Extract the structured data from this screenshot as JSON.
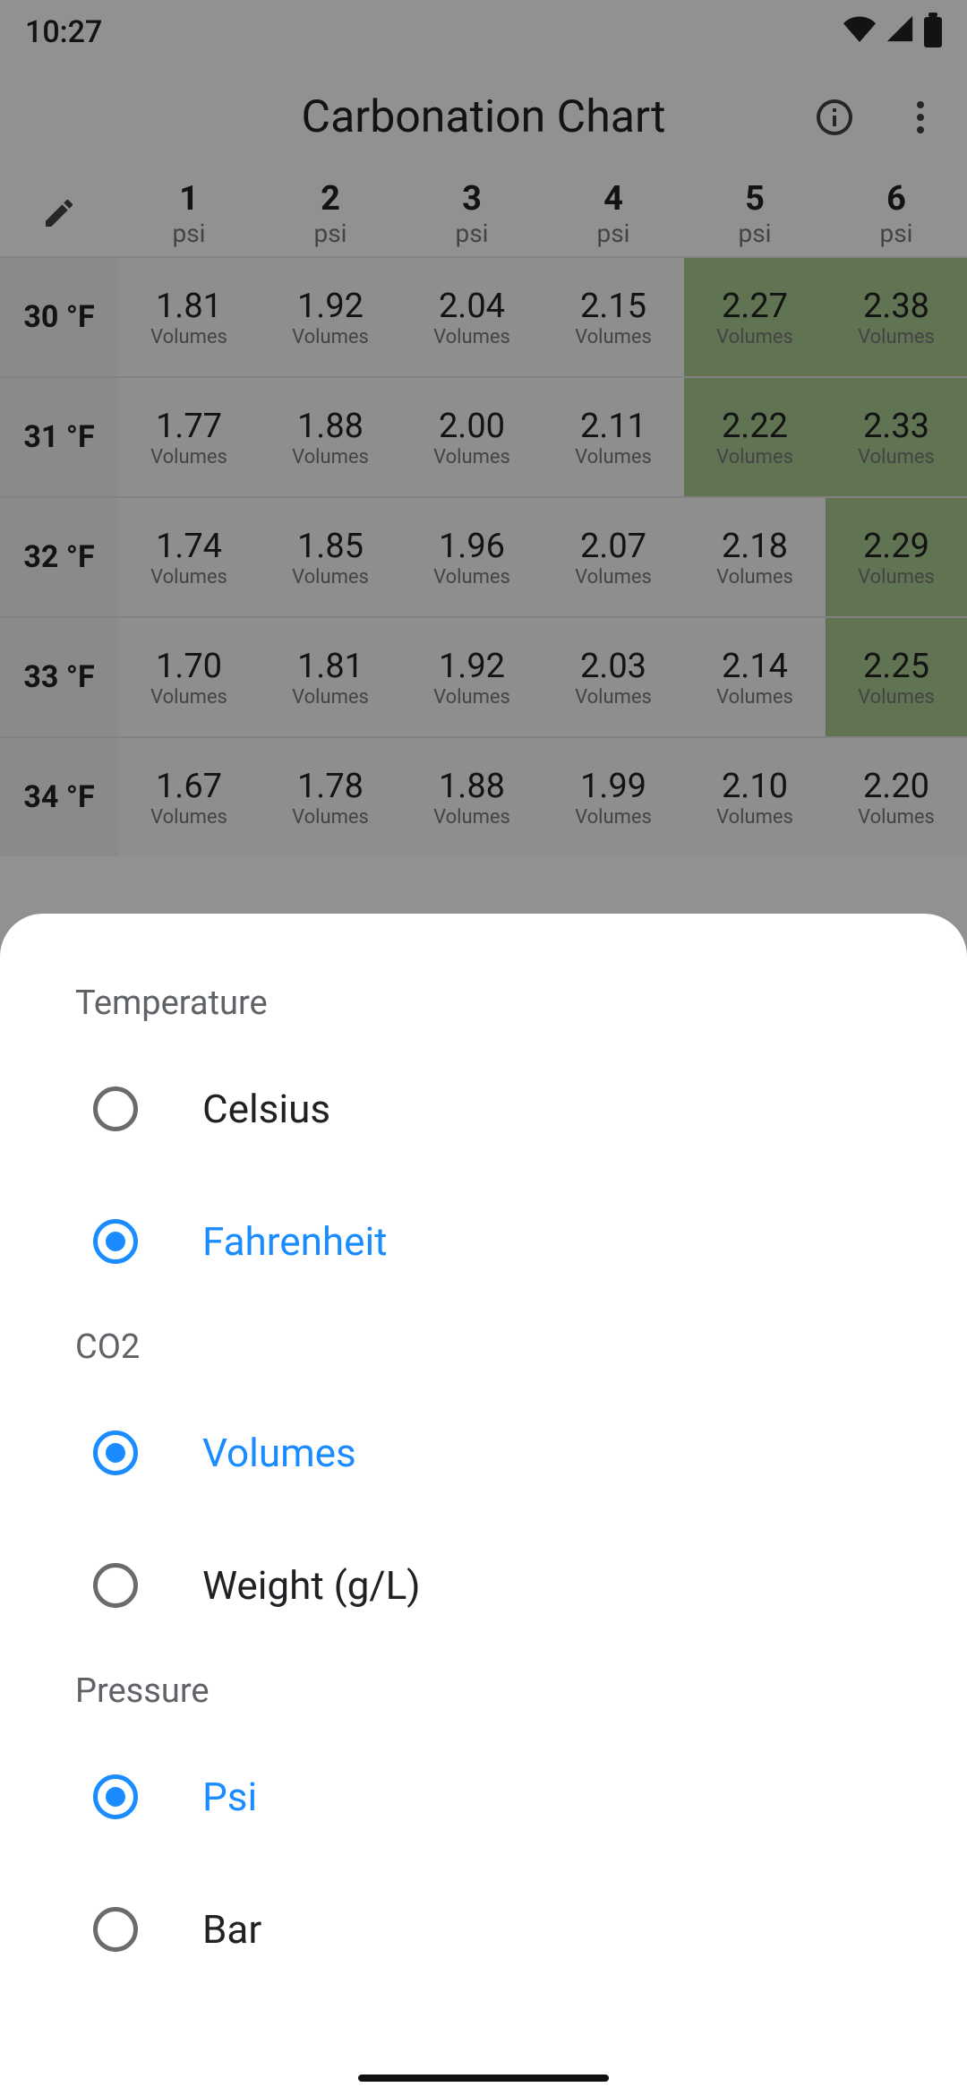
{
  "status": {
    "time": "10:27"
  },
  "appbar": {
    "title": "Carbonation Chart"
  },
  "column_unit": "psi",
  "cell_unit": "Volumes",
  "columns": [
    "1",
    "2",
    "3",
    "4",
    "5",
    "6"
  ],
  "rows": [
    {
      "temp": "30 °F",
      "vals": [
        "1.81",
        "1.92",
        "2.04",
        "2.15",
        "2.27",
        "2.38"
      ],
      "hl": [
        false,
        false,
        false,
        false,
        true,
        true
      ]
    },
    {
      "temp": "31 °F",
      "vals": [
        "1.77",
        "1.88",
        "2.00",
        "2.11",
        "2.22",
        "2.33"
      ],
      "hl": [
        false,
        false,
        false,
        false,
        true,
        true
      ]
    },
    {
      "temp": "32 °F",
      "vals": [
        "1.74",
        "1.85",
        "1.96",
        "2.07",
        "2.18",
        "2.29"
      ],
      "hl": [
        false,
        false,
        false,
        false,
        false,
        true
      ]
    },
    {
      "temp": "33 °F",
      "vals": [
        "1.70",
        "1.81",
        "1.92",
        "2.03",
        "2.14",
        "2.25"
      ],
      "hl": [
        false,
        false,
        false,
        false,
        false,
        true
      ]
    },
    {
      "temp": "34 °F",
      "vals": [
        "1.67",
        "1.78",
        "1.88",
        "1.99",
        "2.10",
        "2.20"
      ],
      "hl": [
        false,
        false,
        false,
        false,
        false,
        false
      ]
    }
  ],
  "sheet": {
    "sections": [
      {
        "title": "Temperature",
        "options": [
          {
            "label": "Celsius",
            "selected": false
          },
          {
            "label": "Fahrenheit",
            "selected": true
          }
        ]
      },
      {
        "title": "CO2",
        "options": [
          {
            "label": "Volumes",
            "selected": true
          },
          {
            "label": "Weight (g/L)",
            "selected": false
          }
        ]
      },
      {
        "title": "Pressure",
        "options": [
          {
            "label": "Psi",
            "selected": true
          },
          {
            "label": "Bar",
            "selected": false
          }
        ]
      }
    ]
  },
  "chart_data": {
    "type": "table",
    "title": "Carbonation Chart",
    "x_unit": "psi",
    "y_unit": "°F",
    "value_unit": "Volumes CO2",
    "columns_psi": [
      1,
      2,
      3,
      4,
      5,
      6
    ],
    "rows": [
      {
        "temp_f": 30,
        "volumes": [
          1.81,
          1.92,
          2.04,
          2.15,
          2.27,
          2.38
        ]
      },
      {
        "temp_f": 31,
        "volumes": [
          1.77,
          1.88,
          2.0,
          2.11,
          2.22,
          2.33
        ]
      },
      {
        "temp_f": 32,
        "volumes": [
          1.74,
          1.85,
          1.96,
          2.07,
          2.18,
          2.29
        ]
      },
      {
        "temp_f": 33,
        "volumes": [
          1.7,
          1.81,
          1.92,
          2.03,
          2.14,
          2.25
        ]
      },
      {
        "temp_f": 34,
        "volumes": [
          1.67,
          1.78,
          1.88,
          1.99,
          2.1,
          2.2
        ]
      }
    ]
  }
}
